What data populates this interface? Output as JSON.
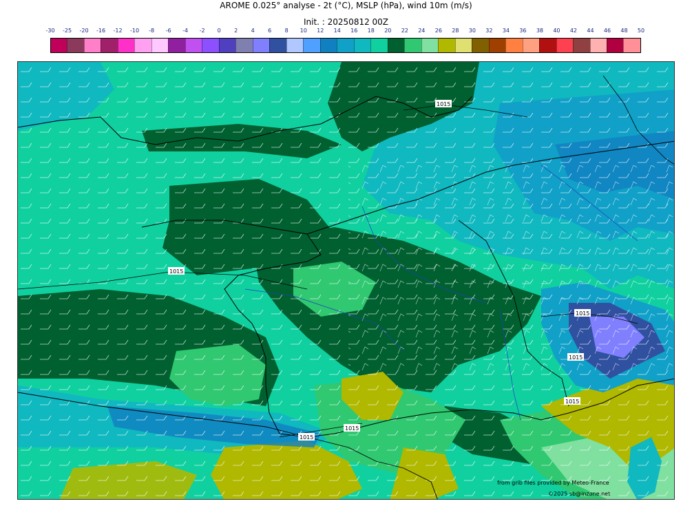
{
  "header": {
    "title": "AROME 0.025° analyse - 2t (°C), MSLP (hPa), wind 10m (m/s)",
    "init": "Init. : 20250812 00Z"
  },
  "legend": {
    "labels": [
      "-30",
      "-25",
      "-20",
      "-16",
      "-12",
      "-10",
      "-8",
      "-6",
      "-4",
      "-2",
      "0",
      "2",
      "4",
      "6",
      "8",
      "10",
      "12",
      "14",
      "16",
      "18",
      "20",
      "22",
      "24",
      "26",
      "28",
      "30",
      "32",
      "34",
      "36",
      "38",
      "40",
      "42",
      "44",
      "46",
      "48",
      "50"
    ],
    "colors": [
      "#c0005a",
      "#8b3a5c",
      "#ff80c8",
      "#a0206a",
      "#ff30c8",
      "#ffa0f0",
      "#ffc8ff",
      "#9020a0",
      "#c050f0",
      "#8c50ff",
      "#5040c0",
      "#8080b0",
      "#8080ff",
      "#3050a0",
      "#b0c8ff",
      "#50a0ff",
      "#1080c0",
      "#10a0c8",
      "#10b8c0",
      "#10d0a0",
      "#006030",
      "#30c870",
      "#80e0a0",
      "#b0b800",
      "#e0e070",
      "#806000",
      "#a04000",
      "#ff8040",
      "#ffa080",
      "#b01010",
      "#ff4050",
      "#904040",
      "#ffb0b0",
      "#b00040",
      "#ff9098"
    ]
  },
  "map": {
    "isobar_labels": [
      "1015",
      "1015",
      "1015",
      "1015",
      "1015",
      "1015",
      "1015"
    ]
  },
  "credits": {
    "line1": "from grib files provided by Meteo-France",
    "line2": "©2025 sb@inzone.net"
  }
}
